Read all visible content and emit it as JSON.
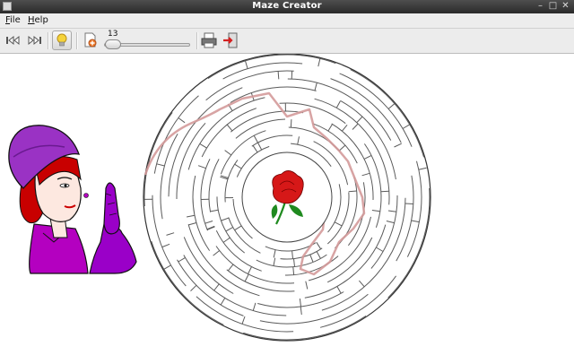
{
  "window": {
    "title": "Maze Creator"
  },
  "menu": {
    "items": [
      {
        "label": "File",
        "accel": "F",
        "rest": "ile"
      },
      {
        "label": "Help",
        "accel": "H",
        "rest": "elp"
      }
    ]
  },
  "toolbar": {
    "icons": [
      "skip-back-icon",
      "skip-forward-icon",
      "lightbulb-icon",
      "new-maze-icon",
      "print-icon",
      "exit-icon"
    ],
    "solution_toggle_active": true,
    "complexity_slider": {
      "value": 13,
      "fraction": 0.05
    }
  },
  "colors": {
    "path": "#d49a9a",
    "walls": "#5a5a5a",
    "rose": "#d61818",
    "leaf": "#1f8a1f",
    "dress": "#b400c0",
    "hair": "#c80000",
    "accent": "#e9a040"
  }
}
